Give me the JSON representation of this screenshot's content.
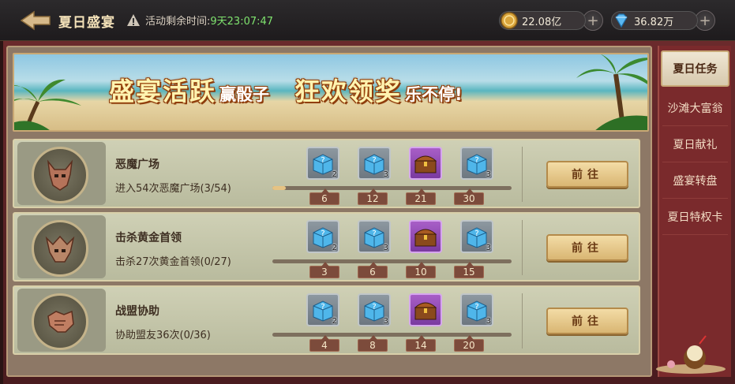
{
  "header": {
    "title": "夏日盛宴",
    "timer_label": "活动剩余时间:",
    "timer_value": "9天23:07:47",
    "gold": {
      "value": "22.08亿",
      "icon": "gold-coin-icon"
    },
    "diamond": {
      "value": "36.82万",
      "icon": "diamond-icon"
    }
  },
  "banner": {
    "part1_big": "盛宴活跃",
    "part1_small": "赢骰子",
    "part2_big": "狂欢领奖",
    "part2_small": "乐不停!"
  },
  "tasks": [
    {
      "name": "恶魔广场",
      "desc": "进入54次恶魔广场(3/54)",
      "emblem": "demon-helmet-icon",
      "progress": 0.056,
      "rewards": [
        {
          "type": "mystery-box",
          "qty": "2"
        },
        {
          "type": "mystery-box",
          "qty": "3"
        },
        {
          "type": "treasure-chest",
          "qty": ""
        },
        {
          "type": "mystery-box",
          "qty": "3"
        }
      ],
      "milestones": [
        "6",
        "12",
        "21",
        "30"
      ],
      "button": "前往"
    },
    {
      "name": "击杀黄金首领",
      "desc": "击杀27次黄金首领(0/27)",
      "emblem": "golden-boss-icon",
      "progress": 0,
      "rewards": [
        {
          "type": "mystery-box",
          "qty": "2"
        },
        {
          "type": "mystery-box",
          "qty": "3"
        },
        {
          "type": "treasure-chest",
          "qty": ""
        },
        {
          "type": "mystery-box",
          "qty": "3"
        }
      ],
      "milestones": [
        "3",
        "6",
        "10",
        "15"
      ],
      "button": "前往"
    },
    {
      "name": "战盟协助",
      "desc": "协助盟友36次(0/36)",
      "emblem": "handshake-icon",
      "progress": 0,
      "rewards": [
        {
          "type": "mystery-box",
          "qty": "2"
        },
        {
          "type": "mystery-box",
          "qty": "3"
        },
        {
          "type": "treasure-chest",
          "qty": ""
        },
        {
          "type": "mystery-box",
          "qty": "3"
        }
      ],
      "milestones": [
        "4",
        "8",
        "14",
        "20"
      ],
      "button": "前往"
    }
  ],
  "sidebar": {
    "items": [
      "夏日任务",
      "沙滩大富翁",
      "夏日献礼",
      "盛宴转盘",
      "夏日特权卡"
    ],
    "active": 0
  },
  "colors": {
    "timer_value": "#7fe36e",
    "banner_text": "#fff3b0",
    "button_bg": "#e8c98a",
    "sidebar_bg": "#7a2a2c"
  }
}
